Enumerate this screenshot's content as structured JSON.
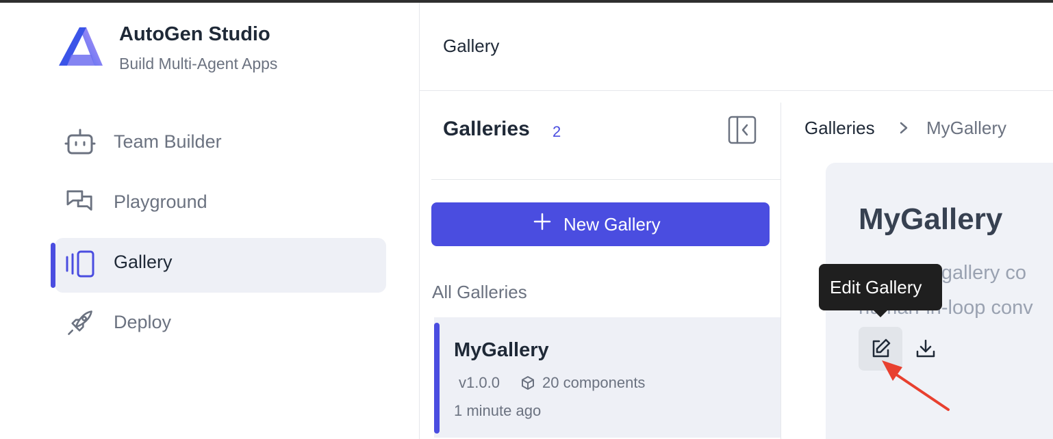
{
  "app": {
    "title": "AutoGen Studio",
    "subtitle": "Build Multi-Agent Apps"
  },
  "sidebar": {
    "items": [
      {
        "label": "Team Builder",
        "icon": "bot-icon",
        "active": false
      },
      {
        "label": "Playground",
        "icon": "chat-icon",
        "active": false
      },
      {
        "label": "Gallery",
        "icon": "gallery-icon",
        "active": true
      },
      {
        "label": "Deploy",
        "icon": "rocket-icon",
        "active": false
      }
    ]
  },
  "header": {
    "title": "Gallery"
  },
  "galleries_panel": {
    "title": "Galleries",
    "count": "2",
    "new_button_label": "New Gallery",
    "section_label": "All Galleries",
    "items": [
      {
        "name": "MyGallery",
        "version": "v1.0.0",
        "components": "20 components",
        "updated": "1 minute ago",
        "selected": true
      }
    ]
  },
  "breadcrumb": {
    "root": "Galleries",
    "current": "MyGallery"
  },
  "detail": {
    "title": "MyGallery",
    "description": "A default gallery co\nhuman-in-loop conv"
  },
  "tooltip": {
    "text": "Edit Gallery"
  },
  "colors": {
    "accent": "#4a4de0",
    "selected_bg": "#eef0f6",
    "tooltip_bg": "#1f1f1f",
    "annotation_arrow": "#e8402f"
  }
}
